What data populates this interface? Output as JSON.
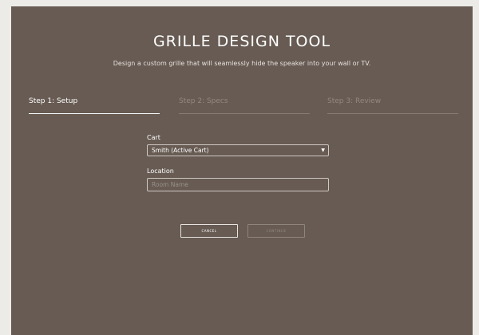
{
  "header": {
    "title": "GRILLE DESIGN TOOL",
    "subtitle": "Design a custom grille that will seamlessly hide the speaker into your wall or TV."
  },
  "steps": [
    {
      "label": "Step 1: Setup",
      "state": "active"
    },
    {
      "label": "Step 2: Specs",
      "state": "inactive"
    },
    {
      "label": "Step 3: Review",
      "state": "inactive"
    }
  ],
  "form": {
    "cart_label": "Cart",
    "cart_value": "Smith (Active Cart)",
    "location_label": "Location",
    "location_placeholder": "Room Name",
    "location_value": ""
  },
  "buttons": {
    "cancel": "CANCEL",
    "continue": "CONTINUE"
  },
  "icons": {
    "dropdown": "chevron-down-icon"
  },
  "colors": {
    "panel_background": "#675b53",
    "page_background": "#ecebe7",
    "text": "#ffffff",
    "muted_text": "#938981"
  }
}
